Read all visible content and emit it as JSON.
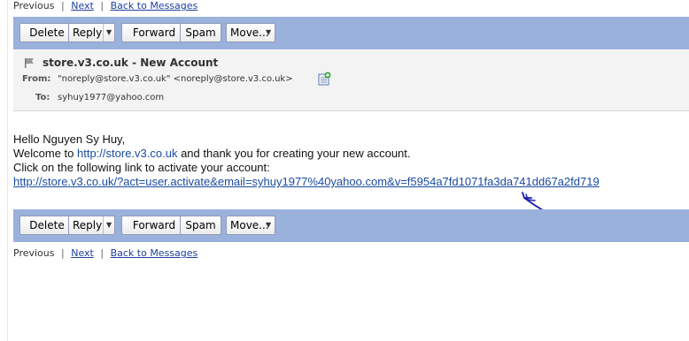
{
  "nav": {
    "previous": "Previous",
    "separator": "|",
    "next": "Next",
    "back": "Back to Messages"
  },
  "toolbar": {
    "delete": "Delete",
    "reply": "Reply",
    "forward": "Forward",
    "spam": "Spam",
    "move": "Move..."
  },
  "message": {
    "subject": "store.v3.co.uk - New Account",
    "from_label": "From:",
    "from_value": "\"noreply@store.v3.co.uk\" <noreply@store.v3.co.uk>",
    "to_label": "To:",
    "to_value": "syhuy1977@yahoo.com",
    "body": {
      "greeting": "Hello Nguyen Sy Huy,",
      "welcome_prefix": "Welcome to ",
      "welcome_link": "http://store.v3.co.uk",
      "welcome_suffix": " and thank you for creating your new account.",
      "instruction": "Click on the following link to activate your account:",
      "activation_link": "http://store.v3.co.uk/?act=user.activate&email=syhuy1977%40yahoo.com&v=f5954a7fd1071fa3da741dd67a2fd719"
    }
  },
  "icons": {
    "flag": "flag-icon",
    "add_contact": "add-contact-icon",
    "dropdown": "chevron-down-icon",
    "annotation": "hand-drawn-arrow"
  },
  "colors": {
    "toolbar": "#9ab1dc",
    "link": "#1a4ba0",
    "annotation": "#1a1ab4"
  }
}
